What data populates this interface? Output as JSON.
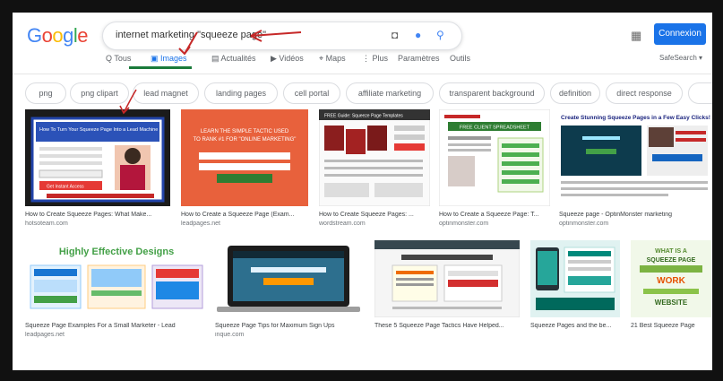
{
  "search": {
    "query": "internet marketing \"squeeze page\""
  },
  "logo": {
    "text": "Google"
  },
  "header": {
    "signin_label": "Connexion",
    "apps_icon": "grid-icon"
  },
  "tabs": [
    {
      "label": "Q Tous",
      "active": false
    },
    {
      "label": "Images",
      "active": true
    },
    {
      "label": "Actualités",
      "active": false
    },
    {
      "label": "Vidéos",
      "active": false
    },
    {
      "label": "Maps",
      "active": false
    },
    {
      "label": "Plus",
      "active": false
    },
    {
      "label": "Paramètres",
      "active": false
    },
    {
      "label": "Outils",
      "active": false
    }
  ],
  "safe_search": "SafeSearch ▾",
  "chips": [
    "png",
    "png clipart",
    "lead magnet",
    "landing pages",
    "cell portal",
    "affiliate marketing",
    "transparent background",
    "definition",
    "direct response"
  ],
  "results_row1": [
    {
      "title": "How to Create Squeeze Pages: What Make...",
      "source": "hotsoteam.com",
      "img_headline": "How To Turn Your Squeeze Page Into a Lead Machine",
      "img_cta": "Get Instant Access"
    },
    {
      "title": "How to Create a Squeeze Page (Exam...",
      "source": "leadpages.net",
      "img_headline": "LEARN THE SIMPLE TACTIC USED TO RANK #1 FOR \"ONLINE MARKETING\""
    },
    {
      "title": "How to Create Squeeze Pages: ...",
      "source": "wordstream.com",
      "img_headline": "FREE Guide: Squeeze Page Templates"
    },
    {
      "title": "How to Create a Squeeze Page: T...",
      "source": "optinmonster.com",
      "img_headline": "FREE CLIENT SPREADSHEET"
    },
    {
      "title": "Squeeze page - OptinMonster marketing",
      "source": "optinmonster.com",
      "img_headline": "Create Stunning Squeeze Pages in a Few Easy Clicks!"
    }
  ],
  "results_row2": [
    {
      "title": "Squeeze Page Examples For a Small Marketer - Lead",
      "source": "leadpages.net",
      "img_headline": "Highly Effective Designs"
    },
    {
      "title": "Squeeze Page Tips for Maximum Sign Ups",
      "source": "inque.com"
    },
    {
      "title": "These 5 Squeeze Page Tactics Have Helped...",
      "source": ""
    },
    {
      "title": "Squeeze Pages and the be...",
      "source": ""
    },
    {
      "title": "21 Best Squeeze Page",
      "source": "",
      "img_headline": "WHAT IS A SQUEEZE PAGE",
      "img_sub": "WORK",
      "img_sub2": "WEBSITE"
    }
  ]
}
